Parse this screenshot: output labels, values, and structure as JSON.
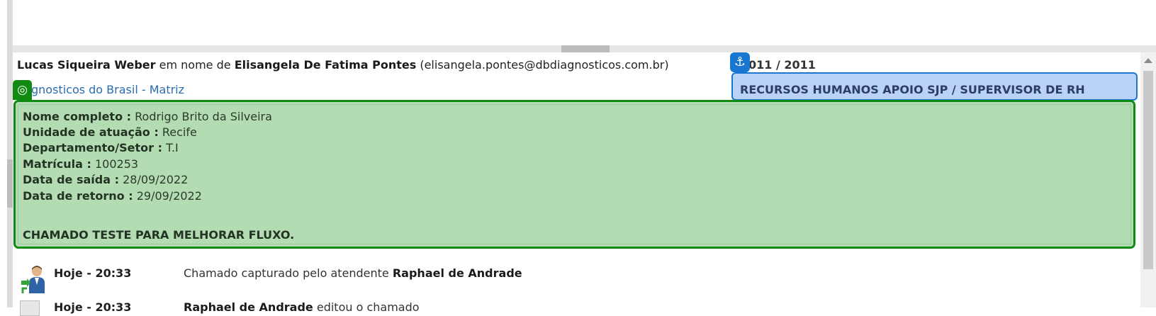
{
  "request": {
    "author": "Lucas Siqueira Weber",
    "on_behalf_text": "em nome de",
    "requester": "Elisangela De Fatima Pontes",
    "requester_email": "(elisangela.pontes@dbdiagnosticos.com.br)",
    "code": "011 / 2011",
    "company": "gnosticos do Brasil - Matriz",
    "department": "RECURSOS HUMANOS APOIO SJP / SUPERVISOR DE RH"
  },
  "details": {
    "fields": [
      {
        "label": "Nome completo :",
        "value": "Rodrigo Brito da Silveira"
      },
      {
        "label": "Unidade de atuação :",
        "value": "Recife"
      },
      {
        "label": "Departamento/Setor :",
        "value": "T.I"
      },
      {
        "label": "Matrícula :",
        "value": "100253"
      },
      {
        "label": "Data de saída :",
        "value": "28/09/2022"
      },
      {
        "label": "Data de retorno :",
        "value": "29/09/2022"
      }
    ],
    "message": "CHAMADO TESTE PARA MELHORAR FLUXO."
  },
  "history": [
    {
      "time": "Hoje - 20:33",
      "text": "Chamado capturado pelo atendente",
      "actor": "Raphael de Andrade",
      "icon": "user-transfer-icon"
    },
    {
      "time": "Hoje - 20:33",
      "text": "editou o chamado",
      "actor": "Raphael de Andrade",
      "icon": "document-icon"
    }
  ],
  "icons": {
    "anchor": "anchor-icon",
    "target": "target-icon"
  },
  "colors": {
    "green_box": "#b3dcb3",
    "green_border": "#118a11",
    "blue_box": "#b9d2f5",
    "blue_border": "#1976d2",
    "link": "#2b6cb0"
  }
}
